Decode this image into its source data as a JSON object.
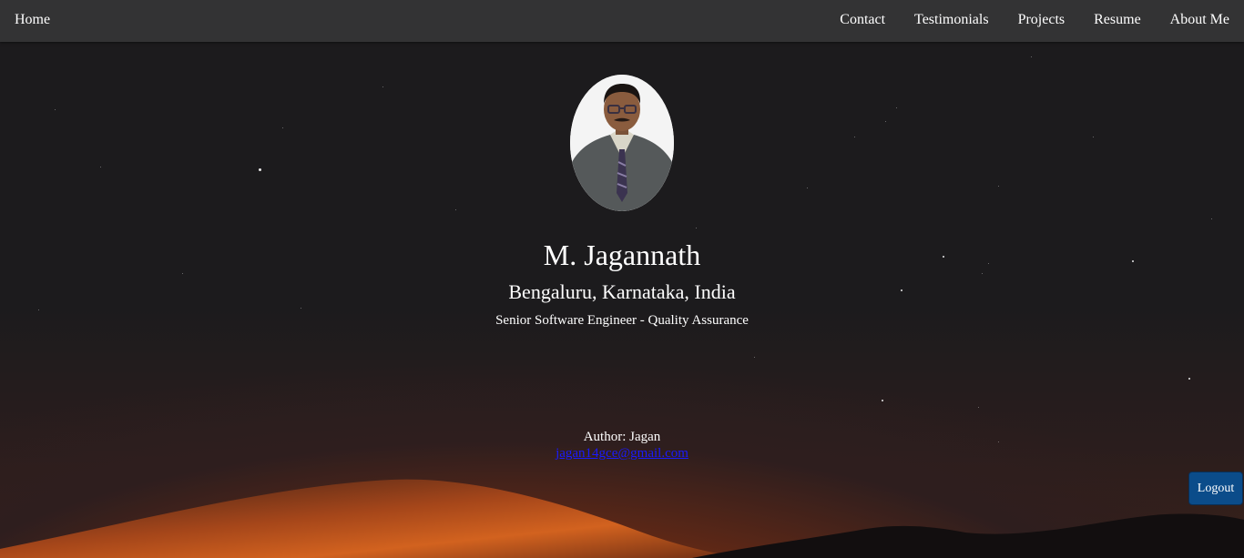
{
  "nav": {
    "home": "Home",
    "links": [
      "Contact",
      "Testimonials",
      "Projects",
      "Resume",
      "About Me"
    ]
  },
  "profile": {
    "name": "M. Jagannath",
    "location": "Bengaluru, Karnataka, India",
    "role": "Senior Software Engineer - Quality Assurance"
  },
  "footer": {
    "author": "Author: Jagan",
    "email": "jagan14gce@gmail.com"
  },
  "logout_label": "Logout"
}
